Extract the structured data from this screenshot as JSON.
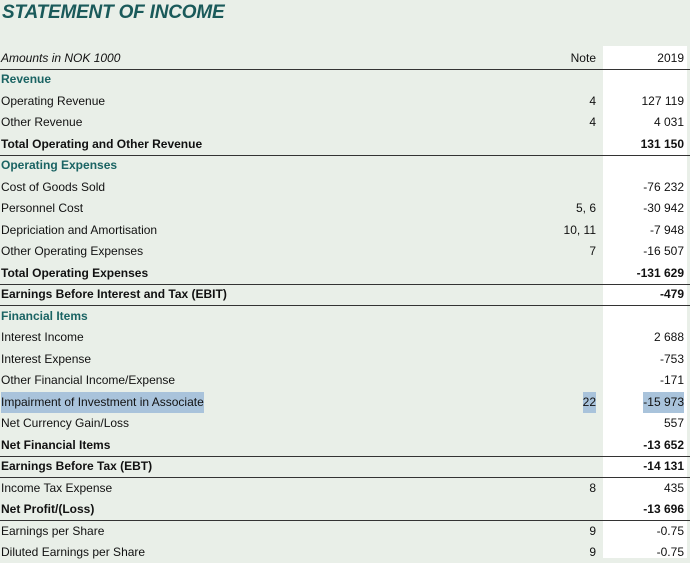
{
  "title": "STATEMENT OF INCOME",
  "header": {
    "label": "Amounts in NOK 1000",
    "note": "Note",
    "year": "2019"
  },
  "rows": [
    {
      "label": "Revenue",
      "note": "",
      "value": "",
      "kind": "section"
    },
    {
      "label": "Operating Revenue",
      "note": "4",
      "value": "127 119",
      "kind": "item"
    },
    {
      "label": "Other Revenue",
      "note": "4",
      "value": "4 031",
      "kind": "item"
    },
    {
      "label": "Total Operating and Other Revenue",
      "note": "",
      "value": "131 150",
      "kind": "total"
    },
    {
      "label": "Operating Expenses",
      "note": "",
      "value": "",
      "kind": "section"
    },
    {
      "label": "Cost of Goods Sold",
      "note": "",
      "value": "-76 232",
      "kind": "item"
    },
    {
      "label": "Personnel Cost",
      "note": "5, 6",
      "value": "-30 942",
      "kind": "item"
    },
    {
      "label": "Depriciation and Amortisation",
      "note": "10, 11",
      "value": "-7 948",
      "kind": "item"
    },
    {
      "label": "Other Operating Expenses",
      "note": "7",
      "value": "-16 507",
      "kind": "item"
    },
    {
      "label": "Total Operating Expenses",
      "note": "",
      "value": "-131 629",
      "kind": "total"
    },
    {
      "label": "Earnings Before Interest and Tax (EBIT)",
      "note": "",
      "value": "-479",
      "kind": "total"
    },
    {
      "label": "Financial Items",
      "note": "",
      "value": "",
      "kind": "section"
    },
    {
      "label": "Interest Income",
      "note": "",
      "value": "2 688",
      "kind": "item"
    },
    {
      "label": "Interest Expense",
      "note": "",
      "value": "-753",
      "kind": "item"
    },
    {
      "label": "Other Financial Income/Expense",
      "note": "",
      "value": "-171",
      "kind": "item"
    },
    {
      "label": "Impairment of Investment in Associate",
      "note": "22",
      "value": "-15 973",
      "kind": "item",
      "highlighted": true
    },
    {
      "label": "Net Currency Gain/Loss",
      "note": "",
      "value": "557",
      "kind": "item"
    },
    {
      "label": "Net Financial Items",
      "note": "",
      "value": "-13 652",
      "kind": "total"
    },
    {
      "label": "Earnings Before Tax (EBT)",
      "note": "",
      "value": "-14 131",
      "kind": "total"
    },
    {
      "label": "Income Tax Expense",
      "note": "8",
      "value": "435",
      "kind": "item"
    },
    {
      "label": "Net Profit/(Loss)",
      "note": "",
      "value": "-13 696",
      "kind": "total"
    },
    {
      "label": "Earnings per Share",
      "note": "9",
      "value": "-0.75",
      "kind": "item"
    },
    {
      "label": "Diluted Earnings per Share",
      "note": "9",
      "value": "-0.75",
      "kind": "item"
    }
  ],
  "colors": {
    "section": "#1a6363",
    "highlight": "#a9c3db",
    "background": "#e9efe8"
  }
}
